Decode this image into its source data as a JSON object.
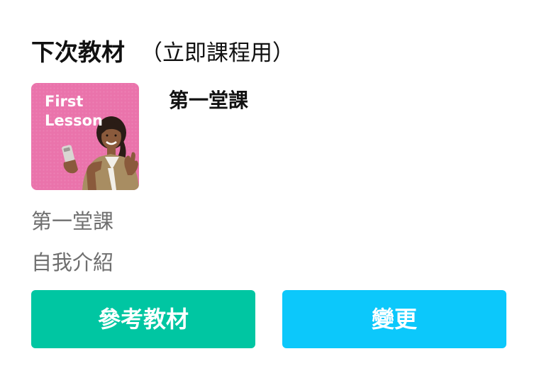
{
  "section": {
    "title": "下次教材",
    "subtitle": "（立即課程用）"
  },
  "material": {
    "thumbnail": {
      "line1": "First",
      "line2": "Lesson",
      "background_color": "#ea73ab"
    },
    "title": "第一堂課",
    "lines": [
      "第一堂課",
      "自我介紹"
    ]
  },
  "buttons": {
    "reference_label": "參考教材",
    "change_label": "變更",
    "reference_color": "#00c6a2",
    "change_color": "#0cc8fb"
  }
}
